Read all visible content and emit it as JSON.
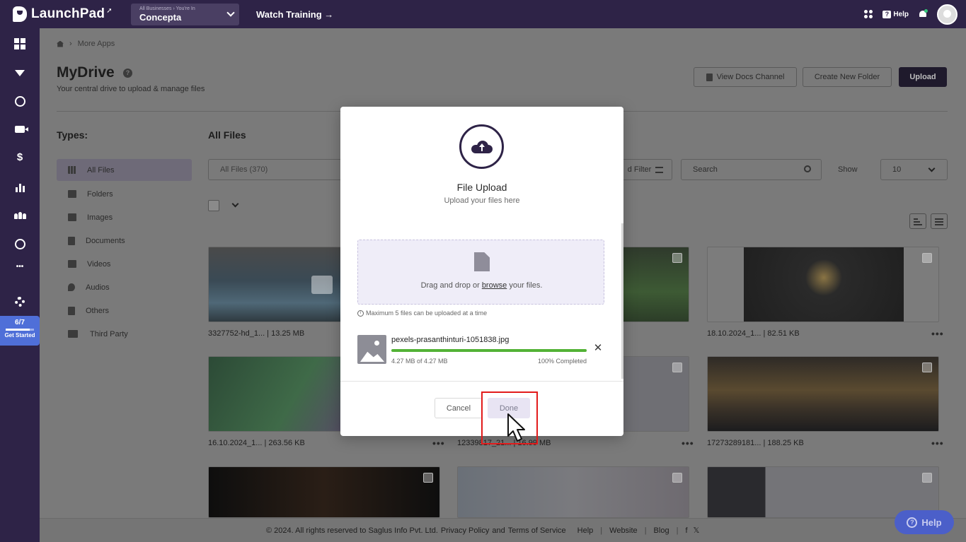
{
  "topbar": {
    "app_name": "LaunchPad",
    "business_hint": "All Businesses › You're In",
    "business_name": "Concepta",
    "watch_training": "Watch Training →",
    "help_label": "Help"
  },
  "rail": {
    "progress_count": "6/7",
    "progress_fraction": 0.857,
    "progress_label": "Get Started",
    "items": [
      "dashboard-icon",
      "funnel-icon",
      "globe-icon",
      "video-icon",
      "dollar-icon",
      "chart-icon",
      "users-icon",
      "gauge-icon",
      "more-icon",
      "settings-icon"
    ],
    "dollar_glyph": "$",
    "more_glyph": "•••"
  },
  "breadcrumb": {
    "home": "home-icon",
    "current": "More Apps",
    "separator": "›"
  },
  "header": {
    "title": "MyDrive",
    "subtitle": "Your central drive to upload & manage files",
    "view_docs": "View Docs Channel",
    "create_folder": "Create New Folder",
    "upload": "Upload"
  },
  "types": {
    "heading": "Types:",
    "items": [
      "All Files",
      "Folders",
      "Images",
      "Documents",
      "Videos",
      "Audios",
      "Others",
      "Third Party"
    ]
  },
  "files": {
    "heading": "All Files",
    "filter_value": "All Files (370)",
    "advanced_filter": "d Filter",
    "search_placeholder": "Search",
    "show_label": "Show",
    "show_value": "10",
    "cards": [
      {
        "caption": "3327752-hd_1... | 13.25 MB"
      },
      {
        "caption": "18.10.2024_1... | 82.51 KB"
      },
      {
        "caption": "16.10.2024_1... | 263.56 KB"
      },
      {
        "caption": "12339817_21... | 16.99 MB"
      },
      {
        "caption": "17273289181... | 188.25 KB"
      }
    ],
    "dots": "•••"
  },
  "footer": {
    "copyright": "©  2024. All rights reserved to Saglus Info Pvt. Ltd.",
    "privacy": "Privacy Policy",
    "and": "and",
    "terms": "Terms of Service",
    "help": "Help",
    "website": "Website",
    "blog": "Blog",
    "sep": "|",
    "facebook": "f",
    "x": "𝕏"
  },
  "help_float": {
    "label": "Help",
    "glyph": "?"
  },
  "modal": {
    "title": "File Upload",
    "subtitle": "Upload your files here",
    "drop_prefix": "Drag and drop or",
    "browse": "browse",
    "drop_suffix": "your files.",
    "max_note": "Maximum 5 files can be uploaded at a time",
    "file": {
      "name": "pexels-prasanthinturi-1051838.jpg",
      "size": "4.27 MB of 4.27 MB",
      "percent_label": "100% Completed",
      "progress": 1.0
    },
    "cancel": "Cancel",
    "done": "Done"
  },
  "colors": {
    "brand": "#2e2347",
    "progress_green": "#53b236",
    "highlight_red": "#e21b1b",
    "help_blue": "#4b5fc9"
  }
}
